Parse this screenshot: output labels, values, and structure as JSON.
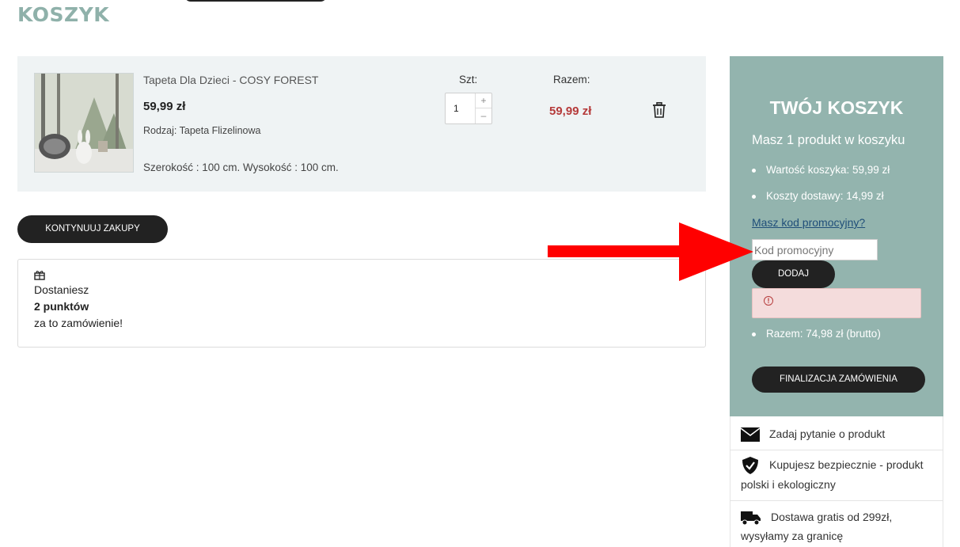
{
  "page": {
    "title": "KOSZYK"
  },
  "cart_item": {
    "name": "Tapeta Dla Dzieci - COSY FOREST",
    "price": "59,99 zł",
    "variant": "Rodzaj: Tapeta Flizelinowa",
    "dimensions": "Szerokość : 100 cm. Wysokość : 100 cm.",
    "qty_label": "Szt:",
    "qty_value": "1",
    "qty_plus": "+",
    "qty_minus": "–",
    "total_label": "Razem:",
    "line_total": "59,99 zł"
  },
  "continue_button": "KONTYNUUJ ZAKUPY",
  "points": {
    "line1": "Dostaniesz",
    "line2": "2 punktów",
    "line3": "za to zamówienie!"
  },
  "sidebar": {
    "title": "TWÓJ KOSZYK",
    "count_text": "Masz 1 produkt w koszyku",
    "cart_value": "Wartość koszyka: 59,99 zł",
    "shipping": "Koszty dostawy: 14,99 zł",
    "promo_link": "Masz kod promocyjny?",
    "promo_placeholder": "Kod promocyjny",
    "add_button": "DODAJ",
    "alert_icon": "!",
    "total": "Razem: 74,98 zł (brutto)",
    "checkout_button": "FINALIZACJA ZAMÓWIENIA"
  },
  "info": [
    {
      "icon": "envelope-icon",
      "text": "Zadaj pytanie o produkt"
    },
    {
      "icon": "shield-check-icon",
      "text": "Kupujesz bezpiecznie - produkt polski i ekologiczny"
    },
    {
      "icon": "truck-icon",
      "text": "Dostawa gratis od 299zł, wysyłamy za granicę"
    }
  ],
  "colors": {
    "accent": "#93b4ae",
    "title": "#8fb1aa",
    "price_red": "#b53a3a",
    "arrow": "#ff0000",
    "button": "#222222"
  }
}
